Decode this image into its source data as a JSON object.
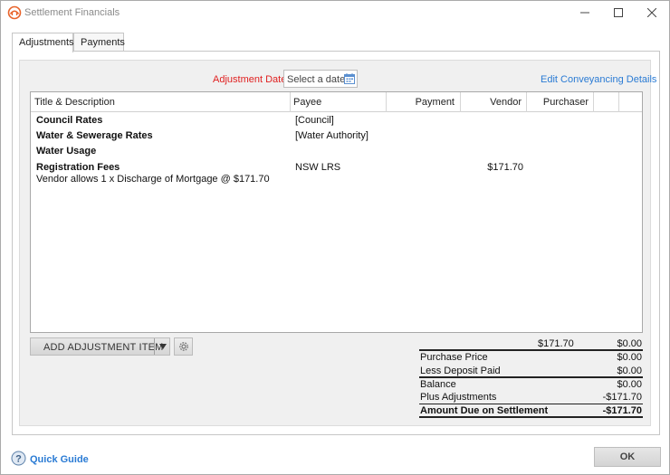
{
  "window": {
    "title": "Settlement Financials",
    "icon": "bridge-logo-icon"
  },
  "tabs": [
    {
      "label": "Adjustments",
      "active": true
    },
    {
      "label": "Payments",
      "active": false
    }
  ],
  "adjustment_date": {
    "label": "Adjustment Date:",
    "placeholder": "Select a date"
  },
  "edit_link": "Edit Conveyancing Details",
  "grid": {
    "columns": [
      "Title & Description",
      "Payee",
      "Payment",
      "Vendor",
      "Purchaser"
    ],
    "rows": [
      {
        "title": "Council Rates",
        "description": "",
        "payee": "[Council]",
        "payment": "",
        "vendor": "",
        "purchaser": ""
      },
      {
        "title": "Water & Sewerage Rates",
        "description": "",
        "payee": "[Water Authority]",
        "payment": "",
        "vendor": "",
        "purchaser": ""
      },
      {
        "title": "Water Usage",
        "description": "",
        "payee": "",
        "payment": "",
        "vendor": "",
        "purchaser": ""
      },
      {
        "title": "Registration Fees",
        "description": "Vendor allows 1 x Discharge of Mortgage @ $171.70",
        "payee": "NSW LRS",
        "payment": "",
        "vendor": "$171.70",
        "purchaser": ""
      }
    ]
  },
  "toolbar": {
    "add_label": "ADD ADJUSTMENT ITEM",
    "dropdown_icon": "triangle-down-icon",
    "settings_icon": "gear-icon"
  },
  "totals": {
    "column_totals": {
      "vendor": "$171.70",
      "purchaser": "$0.00"
    },
    "lines": [
      {
        "label": "Purchase Price",
        "value": "$0.00"
      },
      {
        "label": "Less Deposit Paid",
        "value": "$0.00"
      },
      {
        "label": "Balance",
        "value": "$0.00"
      },
      {
        "label": "Plus Adjustments",
        "value": "-$171.70"
      },
      {
        "label": "Amount Due on Settlement",
        "value": "-$171.70"
      }
    ]
  },
  "footer": {
    "quick_guide": "Quick Guide",
    "ok": "OK"
  },
  "colors": {
    "accent_link": "#2a7bd4",
    "required_label": "#e02020",
    "logo": "#e8632a"
  }
}
